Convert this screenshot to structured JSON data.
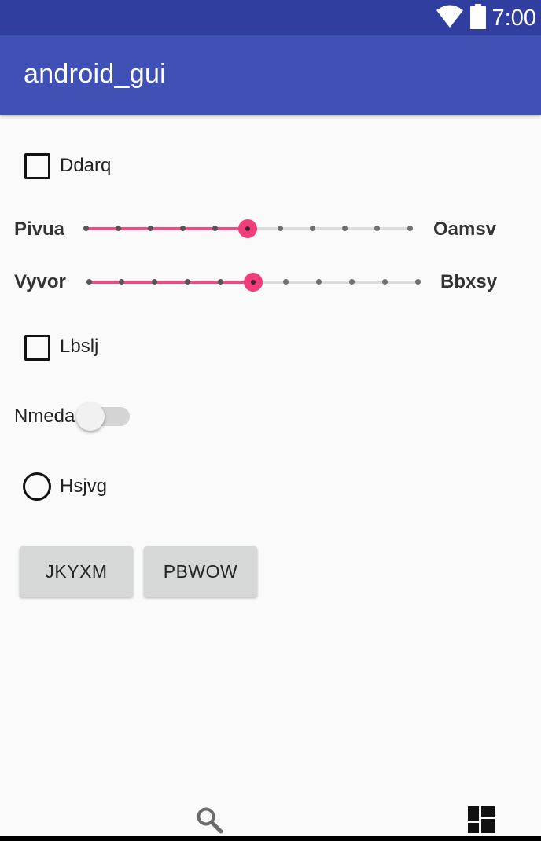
{
  "status_bar": {
    "time": "7:00",
    "icons": [
      "wifi-icon",
      "battery-icon"
    ]
  },
  "app_bar": {
    "title": "android_gui"
  },
  "checkboxes": [
    {
      "label": "Ddarq",
      "checked": false
    },
    {
      "label": "Lbslj",
      "checked": false
    }
  ],
  "seekbars": [
    {
      "left_label": "Pivua",
      "right_label": "Oamsv",
      "steps": 10,
      "value": 5
    },
    {
      "left_label": "Vyvor",
      "right_label": "Bbxsy",
      "steps": 10,
      "value": 5
    }
  ],
  "switch": {
    "label": "Nmeda",
    "on": false
  },
  "radio": {
    "label": "Hsjvg",
    "selected": false
  },
  "buttons": [
    {
      "label": "JKYXM"
    },
    {
      "label": "PBWOW"
    }
  ],
  "bottom_nav": {
    "icons": [
      "search-icon",
      "dashboard-icon"
    ]
  },
  "colors": {
    "status_bar": "#303f9f",
    "app_bar": "#3f51b5",
    "accent": "#f03d7c",
    "background": "#fafafa"
  }
}
